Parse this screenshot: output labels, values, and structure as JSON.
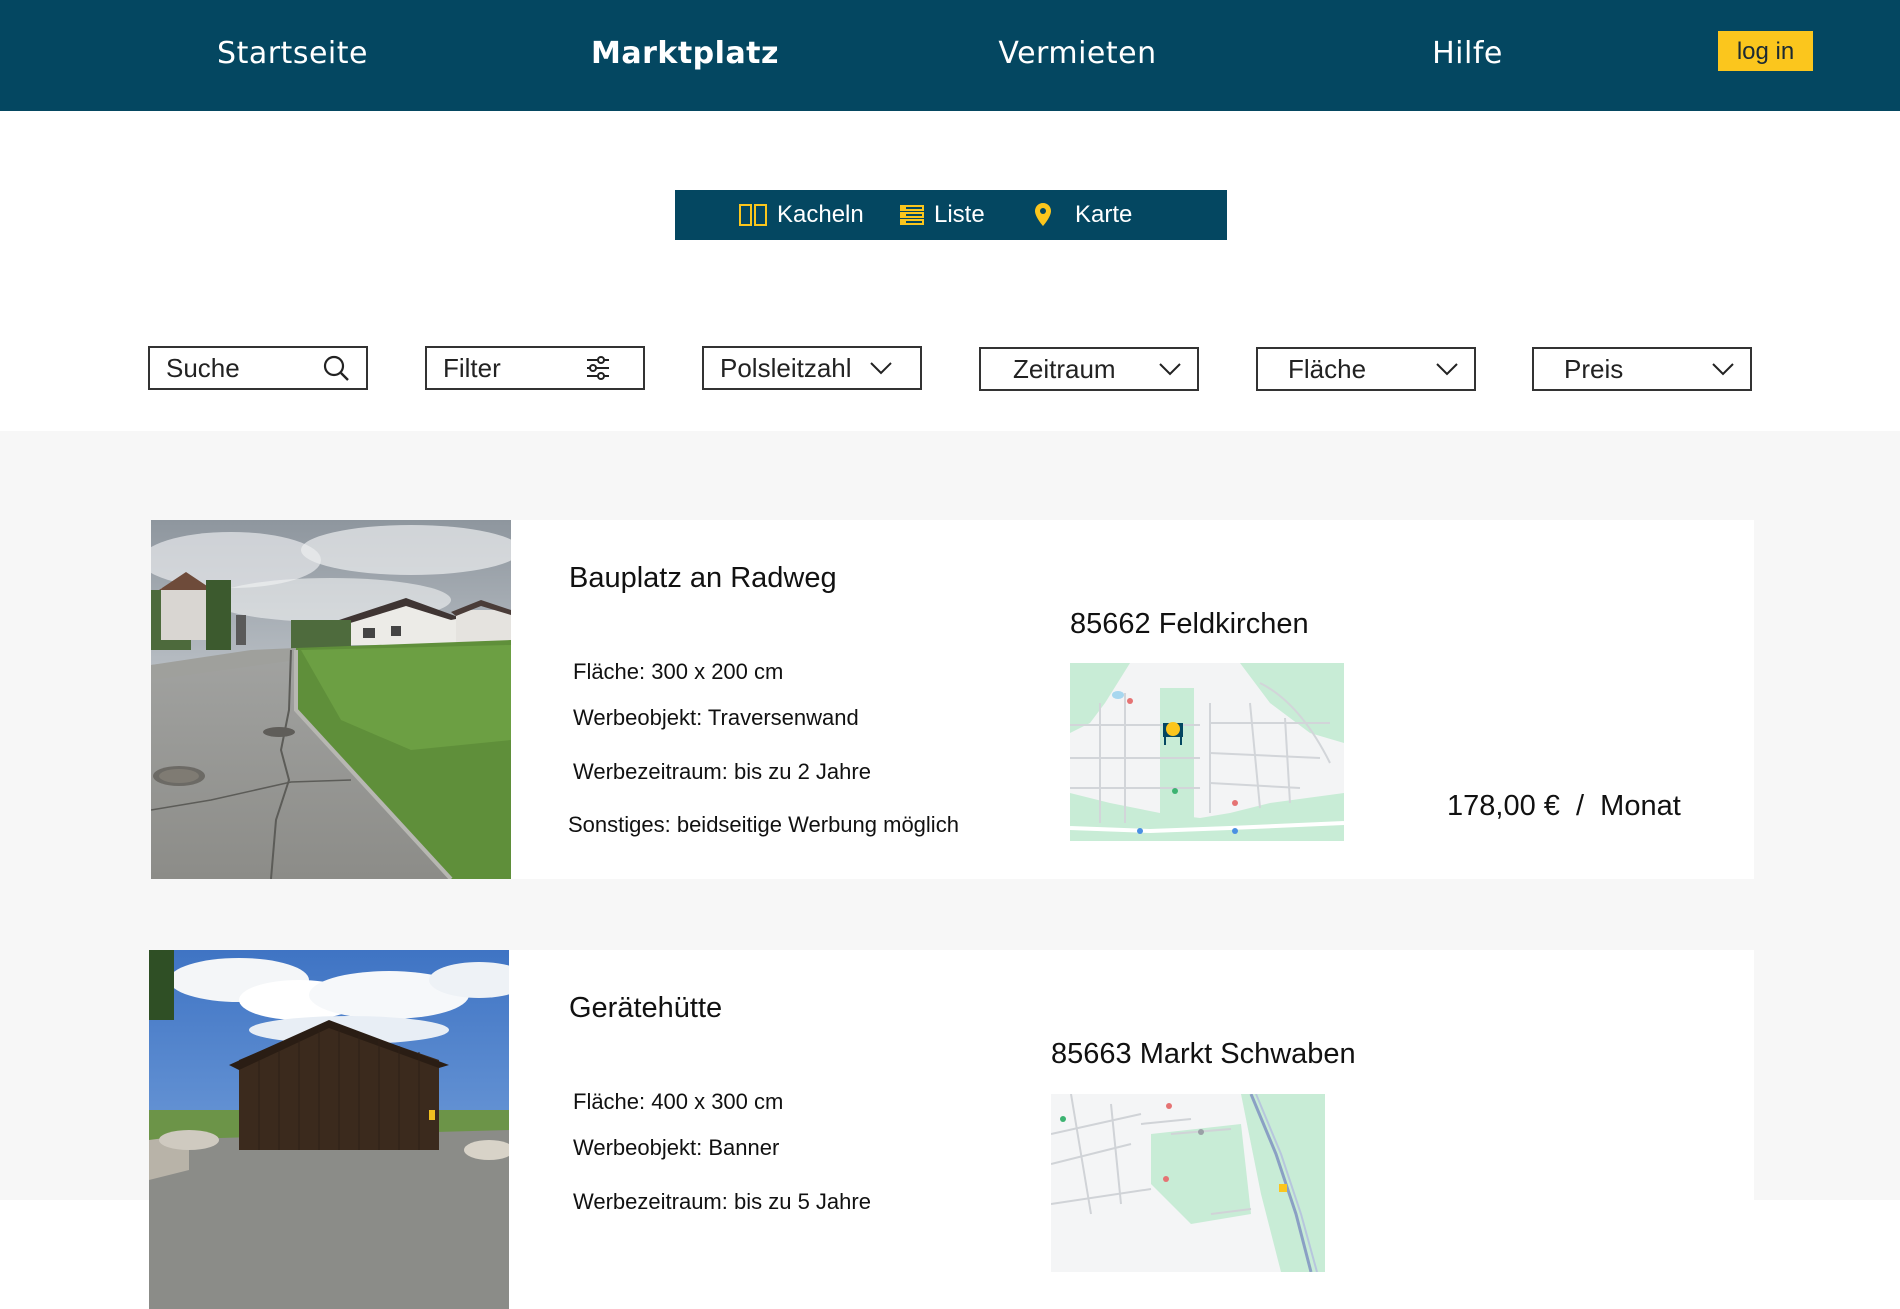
{
  "nav": {
    "items": [
      {
        "label": "Startseite",
        "active": false
      },
      {
        "label": "Marktplatz",
        "active": true
      },
      {
        "label": "Vermieten",
        "active": false
      },
      {
        "label": "Hilfe",
        "active": false
      }
    ],
    "login_label": "log in"
  },
  "view_switch": {
    "tiles_label": "Kacheln",
    "list_label": "Liste",
    "map_label": "Karte"
  },
  "filters": {
    "search_label": "Suche",
    "filter_label": "Filter",
    "postcode_label": "Polsleitzahl",
    "period_label": "Zeitraum",
    "area_label": "Fläche",
    "price_label": "Preis"
  },
  "listings": [
    {
      "title": "Bauplatz an Radweg",
      "details": [
        "Fläche: 300 x 200 cm",
        "Werbeobjekt: Traversenwand",
        "Werbezeitraum: bis zu 2 Jahre",
        "Sonstiges: beidseitige Werbung möglich"
      ],
      "location": "85662 Feldkirchen",
      "price": "178,00 €  /  Monat"
    },
    {
      "title": "Gerätehütte",
      "details": [
        "Fläche: 400 x 300 cm",
        "Werbeobjekt: Banner",
        "Werbezeitraum: bis zu 5 Jahre"
      ],
      "location": "85663 Markt Schwaben"
    }
  ],
  "colors": {
    "brand": "#044761",
    "accent": "#fbc61d",
    "list_background": "#f7f7f7"
  }
}
